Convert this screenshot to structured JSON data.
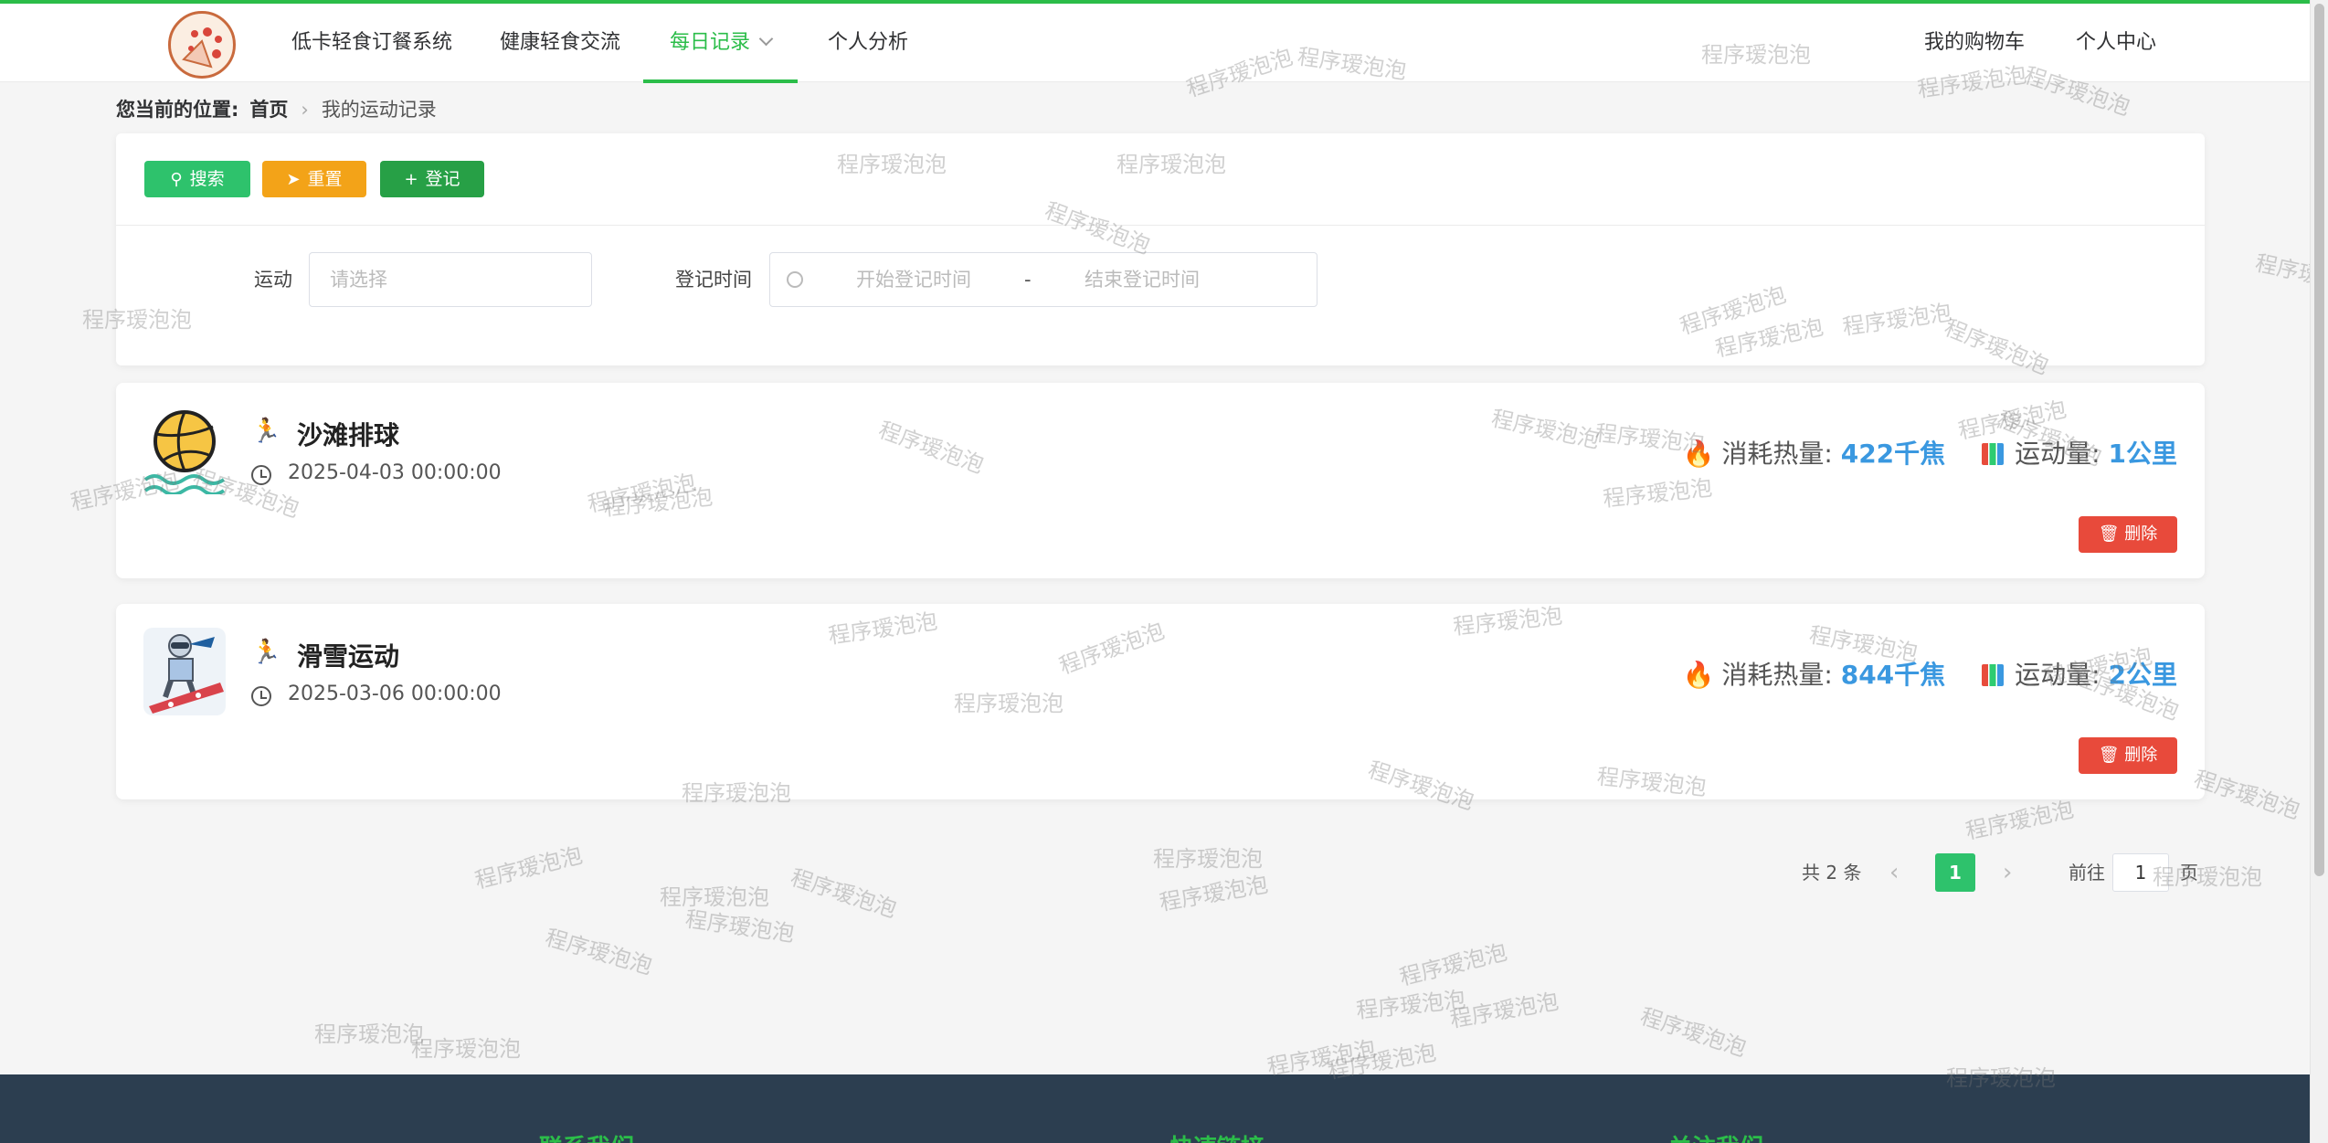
{
  "nav": {
    "items": [
      "低卡轻食订餐系统",
      "健康轻食交流",
      "每日记录",
      "个人分析"
    ],
    "active_index": 2,
    "right": [
      "我的购物车",
      "个人中心"
    ]
  },
  "breadcrumb": {
    "label": "您当前的位置:",
    "home": "首页",
    "current": "我的运动记录"
  },
  "toolbar": {
    "search_label": "搜索",
    "reset_label": "重置",
    "add_label": "登记"
  },
  "filters": {
    "sport_label": "运动",
    "sport_placeholder": "请选择",
    "time_label": "登记时间",
    "time_start_placeholder": "开始登记时间",
    "time_separator": "-",
    "time_end_placeholder": "结束登记时间"
  },
  "records": [
    {
      "name": "沙滩排球",
      "date": "2025-04-03 00:00:00",
      "calorie_label": "消耗热量:",
      "calorie_value": "422千焦",
      "amount_label": "运动量:",
      "amount_value": "1公里",
      "delete_label": "删除"
    },
    {
      "name": "滑雪运动",
      "date": "2025-03-06 00:00:00",
      "calorie_label": "消耗热量:",
      "calorie_value": "844千焦",
      "amount_label": "运动量:",
      "amount_value": "2公里",
      "delete_label": "删除"
    }
  ],
  "pagination": {
    "total": "共 2 条",
    "current": "1",
    "goto_label": "前往",
    "goto_value": "1",
    "page_label": "页"
  },
  "footer": {
    "columns": [
      "联系我们",
      "快速链接",
      "关注我们"
    ]
  },
  "watermark": "程序瑷泡泡",
  "colors": {
    "brand": "#2bbd49",
    "search": "#2ec26c",
    "reset": "#f3a318",
    "add": "#27a046",
    "delete": "#e84a3b",
    "value": "#3a98e0",
    "footer": "#2c3e50"
  }
}
